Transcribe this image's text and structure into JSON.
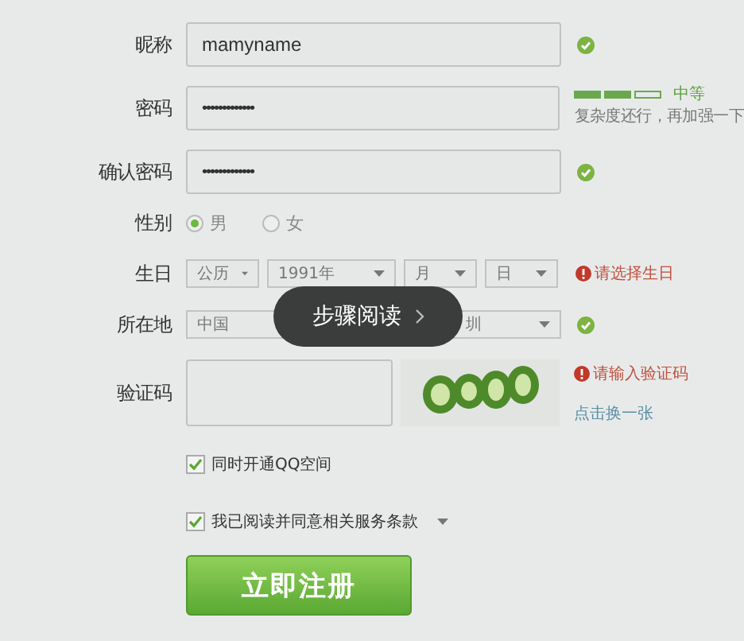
{
  "fields": [
    {
      "label": "昵称",
      "kind": "text",
      "value": "mamyname",
      "valid": true
    },
    {
      "label": "密码",
      "kind": "password",
      "value": "•••••••••••••",
      "strength": {
        "level": 0.67,
        "label": "中等",
        "hint": "复杂度还行，再加强一下"
      }
    },
    {
      "label": "确认密码",
      "kind": "password",
      "value": "•••••••••••••",
      "valid": true
    }
  ],
  "gender": {
    "label": "性别",
    "options": [
      {
        "label": "男",
        "selected": true
      },
      {
        "label": "女",
        "selected": false
      }
    ]
  },
  "birthday": {
    "label": "生日",
    "selects": [
      "公历",
      "1991年",
      "月",
      "日"
    ],
    "error": "请选择生日"
  },
  "location": {
    "label": "所在地",
    "selects": [
      "中国",
      "圳"
    ],
    "valid": true
  },
  "captcha": {
    "label": "验证码",
    "error": "请输入验证码",
    "refresh_link": "点击换一张"
  },
  "checkboxes": [
    {
      "label": "同时开通QQ空间",
      "checked": true,
      "dropdown": false
    },
    {
      "label": "我已阅读并同意相关服务条款",
      "checked": true,
      "dropdown": true
    }
  ],
  "submit": "立即注册",
  "overlay": {
    "label": "步骤阅读"
  }
}
